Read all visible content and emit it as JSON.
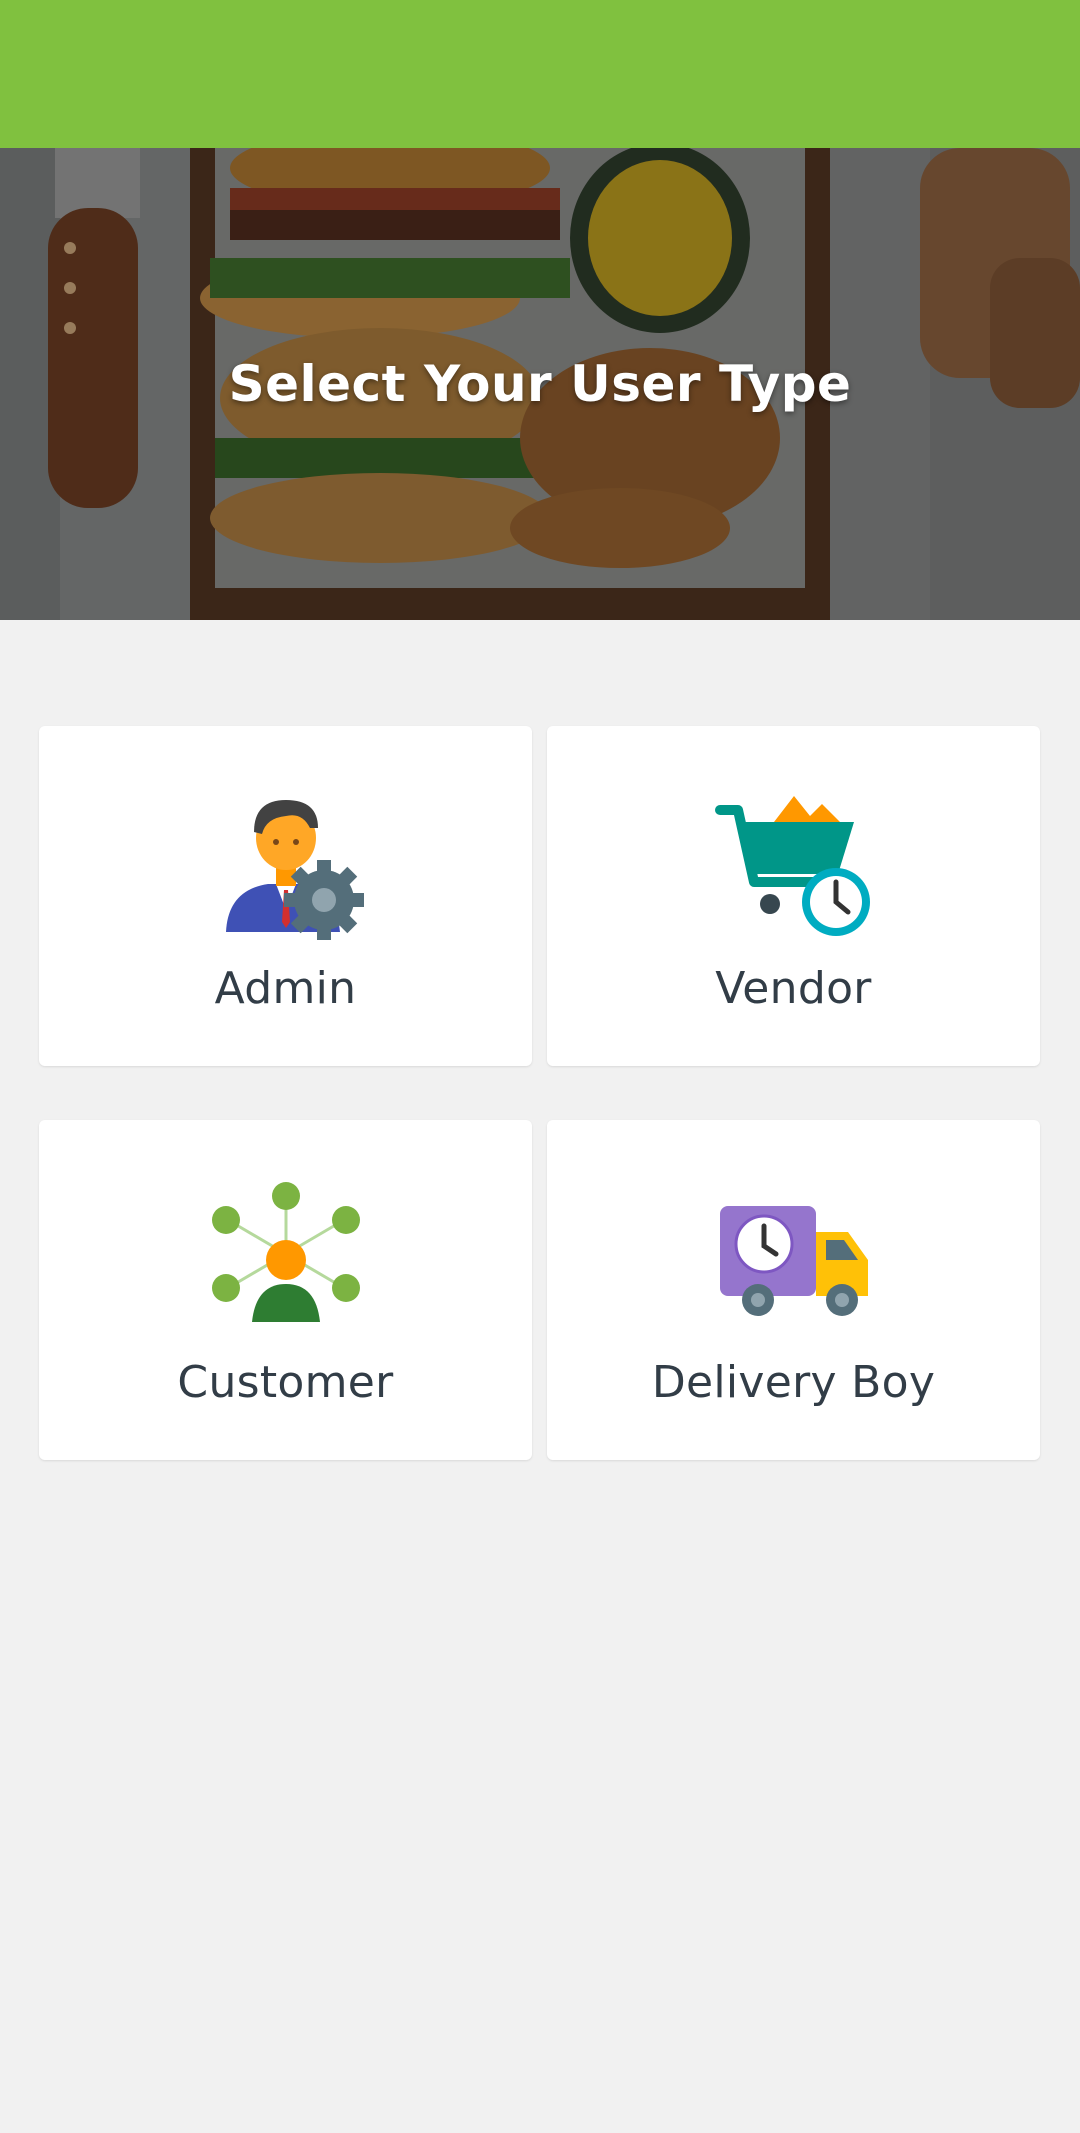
{
  "header": {
    "title": "Select Your User Type",
    "bar_color": "#80c13f"
  },
  "user_types": [
    {
      "label": "Admin",
      "icon": "admin-gear-icon"
    },
    {
      "label": "Vendor",
      "icon": "shopping-cart-clock-icon"
    },
    {
      "label": "Customer",
      "icon": "customer-network-icon"
    },
    {
      "label": "Delivery Boy",
      "icon": "delivery-truck-clock-icon"
    }
  ]
}
